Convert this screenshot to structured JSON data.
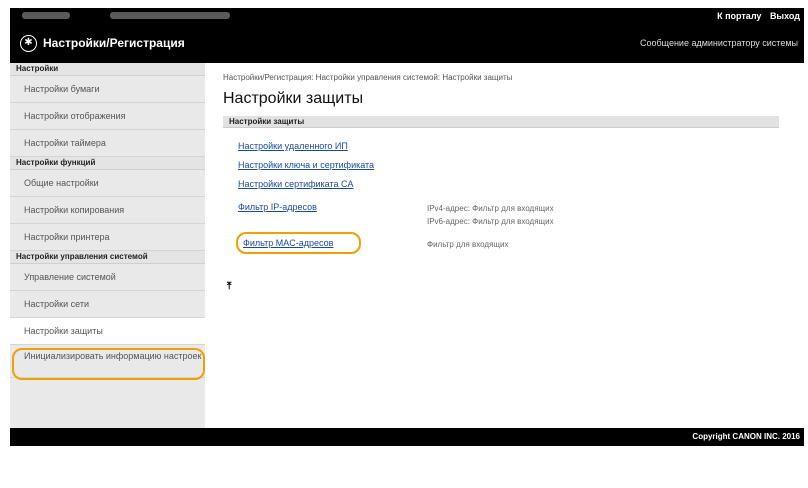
{
  "topbar": {
    "portal_link": "К порталу",
    "logout_link": "Выход"
  },
  "header": {
    "title": "Настройки/Регистрация",
    "admin_link": "Сообщение администратору системы"
  },
  "sidebar": {
    "group1": {
      "title": "Настройки",
      "items": [
        "Настройки бумаги",
        "Настройки отображения",
        "Настройки таймера"
      ]
    },
    "group2": {
      "title": "Настройки функций",
      "items": [
        "Общие настройки",
        "Настройки копирования",
        "Настройки принтера"
      ]
    },
    "group3": {
      "title": "Настройки управления системой",
      "items": [
        "Управление системой",
        "Настройки сети",
        "Настройки защиты"
      ],
      "tall_item": "Инициализировать информацию настроек"
    }
  },
  "main": {
    "breadcrumb": "Настройки/Регистрация: Настройки управления системой: Настройки защиты",
    "title": "Настройки защиты",
    "section": "Настройки защиты",
    "links": [
      "Настройки удаленного ИП",
      "Настройки ключа и сертификата",
      "Настройки сертификата CA",
      "Фильтр IP-адресов",
      "Фильтр MAC-адресов"
    ],
    "ip_desc1": "IPv4-адрес: Фильтр для входящих",
    "ip_desc2": "IPv6-адрес: Фильтр для входящих",
    "mac_desc": "Фильтр для входящих"
  },
  "footer": {
    "copyright": "Copyright CANON INC. 2016"
  },
  "colors": {
    "highlight": "#f0a000",
    "link": "#1a4a9a"
  }
}
